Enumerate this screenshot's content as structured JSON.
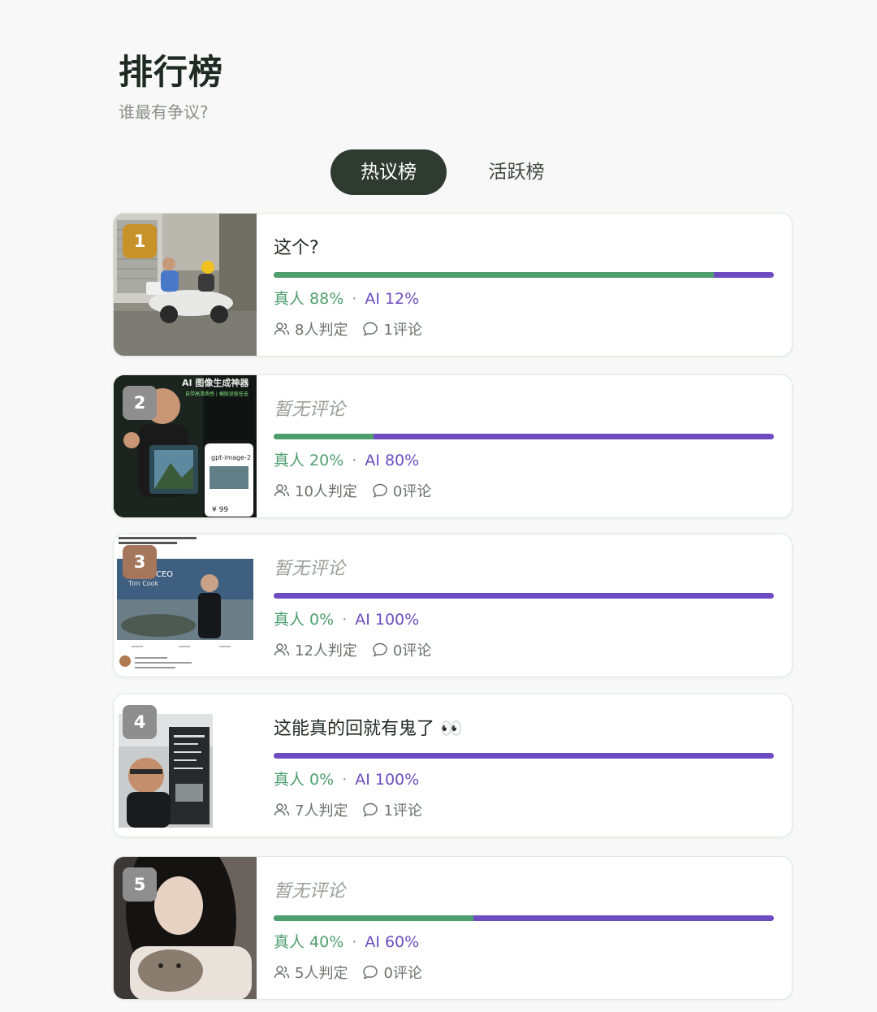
{
  "header": {
    "title": "排行榜",
    "subtitle": "谁最有争议?"
  },
  "tabs": [
    {
      "label": "热议榜",
      "active": true
    },
    {
      "label": "活跃榜",
      "active": false
    }
  ],
  "colors": {
    "human": "#4f9e6e",
    "ai": "#6c4cc0",
    "rank_gold": "#c8922a",
    "rank_gray": "#8e8e8e",
    "rank_bronze": "#a4765c"
  },
  "items": [
    {
      "rank": "1",
      "comment": "这个?",
      "human_label": "真人 88%",
      "ai_label": "AI 12%",
      "human_ratio": 0.88,
      "judges": "8人判定",
      "comments": "1评论"
    },
    {
      "rank": "2",
      "comment": "暂无评论",
      "human_label": "真人 20%",
      "ai_label": "AI 80%",
      "human_ratio": 0.2,
      "judges": "10人判定",
      "comments": "0评论",
      "thumb_text": {
        "headline": "AI 图像生成神器",
        "sub": "自带高清质感 | 横版竖版任选",
        "badge": "gpt-image-2",
        "price": "¥ 99"
      }
    },
    {
      "rank": "3",
      "comment": "暂无评论",
      "human_label": "真人 0%",
      "ai_label": "AI 100%",
      "human_ratio": 0.0,
      "judges": "12人判定",
      "comments": "0评论",
      "thumb_text": {
        "ceo": "CEO",
        "name": "Tim Cook"
      }
    },
    {
      "rank": "4",
      "comment": "这能真的回就有鬼了 👀",
      "human_label": "真人 0%",
      "ai_label": "AI 100%",
      "human_ratio": 0.0,
      "judges": "7人判定",
      "comments": "1评论"
    },
    {
      "rank": "5",
      "comment": "暂无评论",
      "human_label": "真人 40%",
      "ai_label": "AI 60%",
      "human_ratio": 0.4,
      "judges": "5人判定",
      "comments": "0评论"
    }
  ]
}
